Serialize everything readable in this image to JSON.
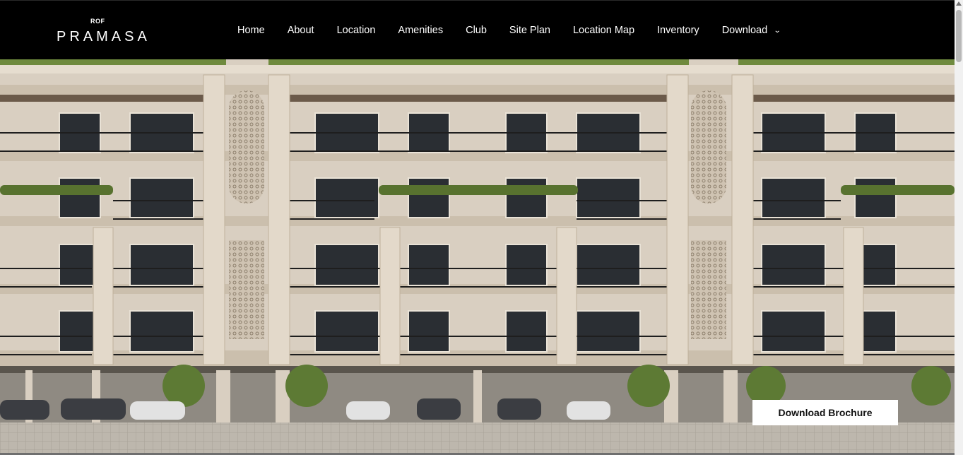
{
  "brand": {
    "sub": "ROF",
    "name": "PRAMASA"
  },
  "nav": [
    {
      "label": "Home"
    },
    {
      "label": "About"
    },
    {
      "label": "Location"
    },
    {
      "label": "Amenities"
    },
    {
      "label": "Club"
    },
    {
      "label": "Site Plan"
    },
    {
      "label": "Location Map"
    },
    {
      "label": "Inventory"
    },
    {
      "label": "Download",
      "icon": "chevron-down-icon"
    }
  ],
  "hero": {
    "cta_label": "Download Brochure"
  },
  "colors": {
    "header_bg": "#000000",
    "facade": "#d9cfc1",
    "cta_bg": "#ffffff"
  }
}
